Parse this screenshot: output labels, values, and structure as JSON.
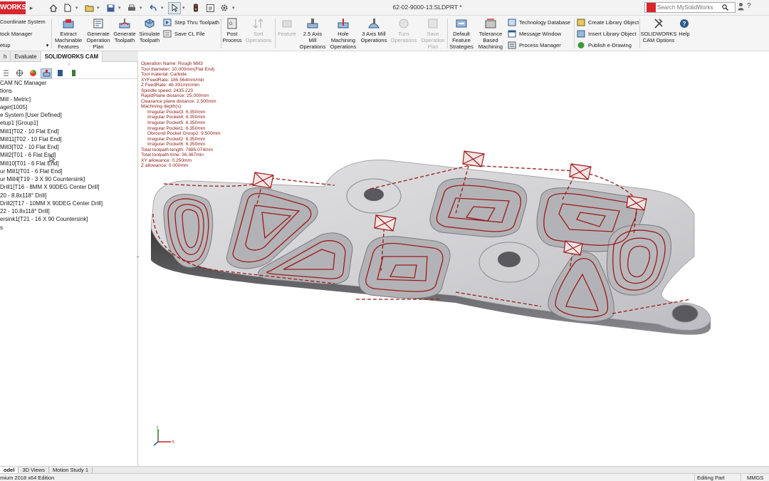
{
  "app": {
    "logo_text": "WORKS",
    "document_title": "62-02-9000-13.SLDPRT *",
    "search_placeholder": "Search MySolidWorks"
  },
  "ribbon": {
    "coord_system": "Coordinate System",
    "stock_manager": "tock Manager",
    "setup": "etup",
    "extract": "Extract Machinable Features",
    "gen_plan": "Generate Operation Plan",
    "gen_toolpath": "Generate Toolpath",
    "simulate": "Simulate Toolpath",
    "step_thru": "Step Thru Toolpath",
    "save_cl": "Save CL File",
    "post": "Post Process",
    "sort_ops": "Sort Operations",
    "feature": "Feature",
    "mill_25": "2.5 Axis Mill Operations",
    "hole_ops": "Hole Machining Operations",
    "mill_3": "3 Axis Mill Operations",
    "turn_ops": "Turn Operations",
    "save_plan": "Save Operation Plan",
    "default_strat": "Default Feature Strategies",
    "tolerance": "Tolerance Based Machining",
    "tech_db": "Technology Database",
    "msg_window": "Message Window",
    "proc_mgr": "Process Manager",
    "create_lib": "Create Library Object",
    "insert_lib": "Insert Library Object",
    "publish": "Publish e-Drawing",
    "sw_cam_options": "SOLIDWORKS CAM Options",
    "help": "Help"
  },
  "tabs": [
    {
      "label": "h"
    },
    {
      "label": "Evaluate"
    },
    {
      "label": "SOLIDWORKS CAM"
    }
  ],
  "tree": [
    "CAM NC Manager",
    "tions",
    "Mill - Metric]",
    "ager[1005]",
    "e System [User Defined]",
    "etup1 [Group1]",
    "Mill1[T02 - 10 Flat End]",
    "Mill11[T02 - 10 Flat End]",
    "Mill3[T02 - 10 Flat End]",
    "Mill2[T01 - 6 Flat End]",
    "Mill10[T01 - 6 Flat End]",
    "ur Mill1[T01 - 6 Flat End]",
    "ur Mill4[T19 - 3 X 90 Countersink]",
    "Drill1[T16 - 8MM X 90DEG Center Drill]",
    "20 - 8.8x118° Drill]",
    "Drill2[T17 - 10MM X 90DEG Center Drill]",
    "22 - 10.8x118° Drill]",
    "ersink1[T21 - 16 X 90 Countersink]",
    "s"
  ],
  "opinfo": {
    "lines": [
      "Operation Name: Rough Mill3",
      "Tool diameter: 10.000mm(Flat End)",
      "Tool material: Carbide",
      "XYFeedRate: 185.564mm/min",
      "Z FeedRate: 46.391mm/min",
      "Spindle speed: 2435.223",
      "RapidPlane distance: 25.000mm",
      "Clearance plane distance: 2.500mm",
      "Machining depth(s):"
    ],
    "depths": [
      "Irregular Pocket3: 6.350mm",
      "Irregular Pocket4: 6.350mm",
      "Irregular Pocket5: 6.350mm",
      "Irregular Pocket1: 6.350mm",
      "Obround Pocket Group2: 9.500mm",
      "Irregular Pocket2: 6.350mm",
      "Irregular Pocket6: 6.350mm"
    ],
    "totals": [
      "Total toolpath length: 7885.074mm",
      "Total toolpath time: 36.367min",
      "XY allowance: 0.250mm",
      "Z allowance: 0.000mm"
    ]
  },
  "bottom_tabs": [
    {
      "label": "odel"
    },
    {
      "label": "3D Views"
    },
    {
      "label": "Motion Study 1"
    }
  ],
  "status": {
    "edition": "mium 2018 x64 Edition",
    "mode": "Editing Part",
    "units": "MMGS"
  },
  "colors": {
    "brand": "#d8262d",
    "toolpath": "#9b1b1b",
    "part": "#c9c9cb"
  }
}
